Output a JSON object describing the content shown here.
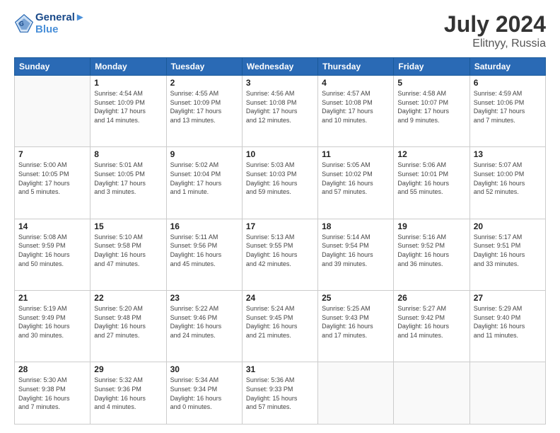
{
  "header": {
    "logo_line1": "General",
    "logo_line2": "Blue",
    "month": "July 2024",
    "location": "Elitnyy, Russia"
  },
  "weekdays": [
    "Sunday",
    "Monday",
    "Tuesday",
    "Wednesday",
    "Thursday",
    "Friday",
    "Saturday"
  ],
  "weeks": [
    [
      {
        "day": "",
        "info": ""
      },
      {
        "day": "1",
        "info": "Sunrise: 4:54 AM\nSunset: 10:09 PM\nDaylight: 17 hours\nand 14 minutes."
      },
      {
        "day": "2",
        "info": "Sunrise: 4:55 AM\nSunset: 10:09 PM\nDaylight: 17 hours\nand 13 minutes."
      },
      {
        "day": "3",
        "info": "Sunrise: 4:56 AM\nSunset: 10:08 PM\nDaylight: 17 hours\nand 12 minutes."
      },
      {
        "day": "4",
        "info": "Sunrise: 4:57 AM\nSunset: 10:08 PM\nDaylight: 17 hours\nand 10 minutes."
      },
      {
        "day": "5",
        "info": "Sunrise: 4:58 AM\nSunset: 10:07 PM\nDaylight: 17 hours\nand 9 minutes."
      },
      {
        "day": "6",
        "info": "Sunrise: 4:59 AM\nSunset: 10:06 PM\nDaylight: 17 hours\nand 7 minutes."
      }
    ],
    [
      {
        "day": "7",
        "info": "Sunrise: 5:00 AM\nSunset: 10:05 PM\nDaylight: 17 hours\nand 5 minutes."
      },
      {
        "day": "8",
        "info": "Sunrise: 5:01 AM\nSunset: 10:05 PM\nDaylight: 17 hours\nand 3 minutes."
      },
      {
        "day": "9",
        "info": "Sunrise: 5:02 AM\nSunset: 10:04 PM\nDaylight: 17 hours\nand 1 minute."
      },
      {
        "day": "10",
        "info": "Sunrise: 5:03 AM\nSunset: 10:03 PM\nDaylight: 16 hours\nand 59 minutes."
      },
      {
        "day": "11",
        "info": "Sunrise: 5:05 AM\nSunset: 10:02 PM\nDaylight: 16 hours\nand 57 minutes."
      },
      {
        "day": "12",
        "info": "Sunrise: 5:06 AM\nSunset: 10:01 PM\nDaylight: 16 hours\nand 55 minutes."
      },
      {
        "day": "13",
        "info": "Sunrise: 5:07 AM\nSunset: 10:00 PM\nDaylight: 16 hours\nand 52 minutes."
      }
    ],
    [
      {
        "day": "14",
        "info": "Sunrise: 5:08 AM\nSunset: 9:59 PM\nDaylight: 16 hours\nand 50 minutes."
      },
      {
        "day": "15",
        "info": "Sunrise: 5:10 AM\nSunset: 9:58 PM\nDaylight: 16 hours\nand 47 minutes."
      },
      {
        "day": "16",
        "info": "Sunrise: 5:11 AM\nSunset: 9:56 PM\nDaylight: 16 hours\nand 45 minutes."
      },
      {
        "day": "17",
        "info": "Sunrise: 5:13 AM\nSunset: 9:55 PM\nDaylight: 16 hours\nand 42 minutes."
      },
      {
        "day": "18",
        "info": "Sunrise: 5:14 AM\nSunset: 9:54 PM\nDaylight: 16 hours\nand 39 minutes."
      },
      {
        "day": "19",
        "info": "Sunrise: 5:16 AM\nSunset: 9:52 PM\nDaylight: 16 hours\nand 36 minutes."
      },
      {
        "day": "20",
        "info": "Sunrise: 5:17 AM\nSunset: 9:51 PM\nDaylight: 16 hours\nand 33 minutes."
      }
    ],
    [
      {
        "day": "21",
        "info": "Sunrise: 5:19 AM\nSunset: 9:49 PM\nDaylight: 16 hours\nand 30 minutes."
      },
      {
        "day": "22",
        "info": "Sunrise: 5:20 AM\nSunset: 9:48 PM\nDaylight: 16 hours\nand 27 minutes."
      },
      {
        "day": "23",
        "info": "Sunrise: 5:22 AM\nSunset: 9:46 PM\nDaylight: 16 hours\nand 24 minutes."
      },
      {
        "day": "24",
        "info": "Sunrise: 5:24 AM\nSunset: 9:45 PM\nDaylight: 16 hours\nand 21 minutes."
      },
      {
        "day": "25",
        "info": "Sunrise: 5:25 AM\nSunset: 9:43 PM\nDaylight: 16 hours\nand 17 minutes."
      },
      {
        "day": "26",
        "info": "Sunrise: 5:27 AM\nSunset: 9:42 PM\nDaylight: 16 hours\nand 14 minutes."
      },
      {
        "day": "27",
        "info": "Sunrise: 5:29 AM\nSunset: 9:40 PM\nDaylight: 16 hours\nand 11 minutes."
      }
    ],
    [
      {
        "day": "28",
        "info": "Sunrise: 5:30 AM\nSunset: 9:38 PM\nDaylight: 16 hours\nand 7 minutes."
      },
      {
        "day": "29",
        "info": "Sunrise: 5:32 AM\nSunset: 9:36 PM\nDaylight: 16 hours\nand 4 minutes."
      },
      {
        "day": "30",
        "info": "Sunrise: 5:34 AM\nSunset: 9:34 PM\nDaylight: 16 hours\nand 0 minutes."
      },
      {
        "day": "31",
        "info": "Sunrise: 5:36 AM\nSunset: 9:33 PM\nDaylight: 15 hours\nand 57 minutes."
      },
      {
        "day": "",
        "info": ""
      },
      {
        "day": "",
        "info": ""
      },
      {
        "day": "",
        "info": ""
      }
    ]
  ]
}
